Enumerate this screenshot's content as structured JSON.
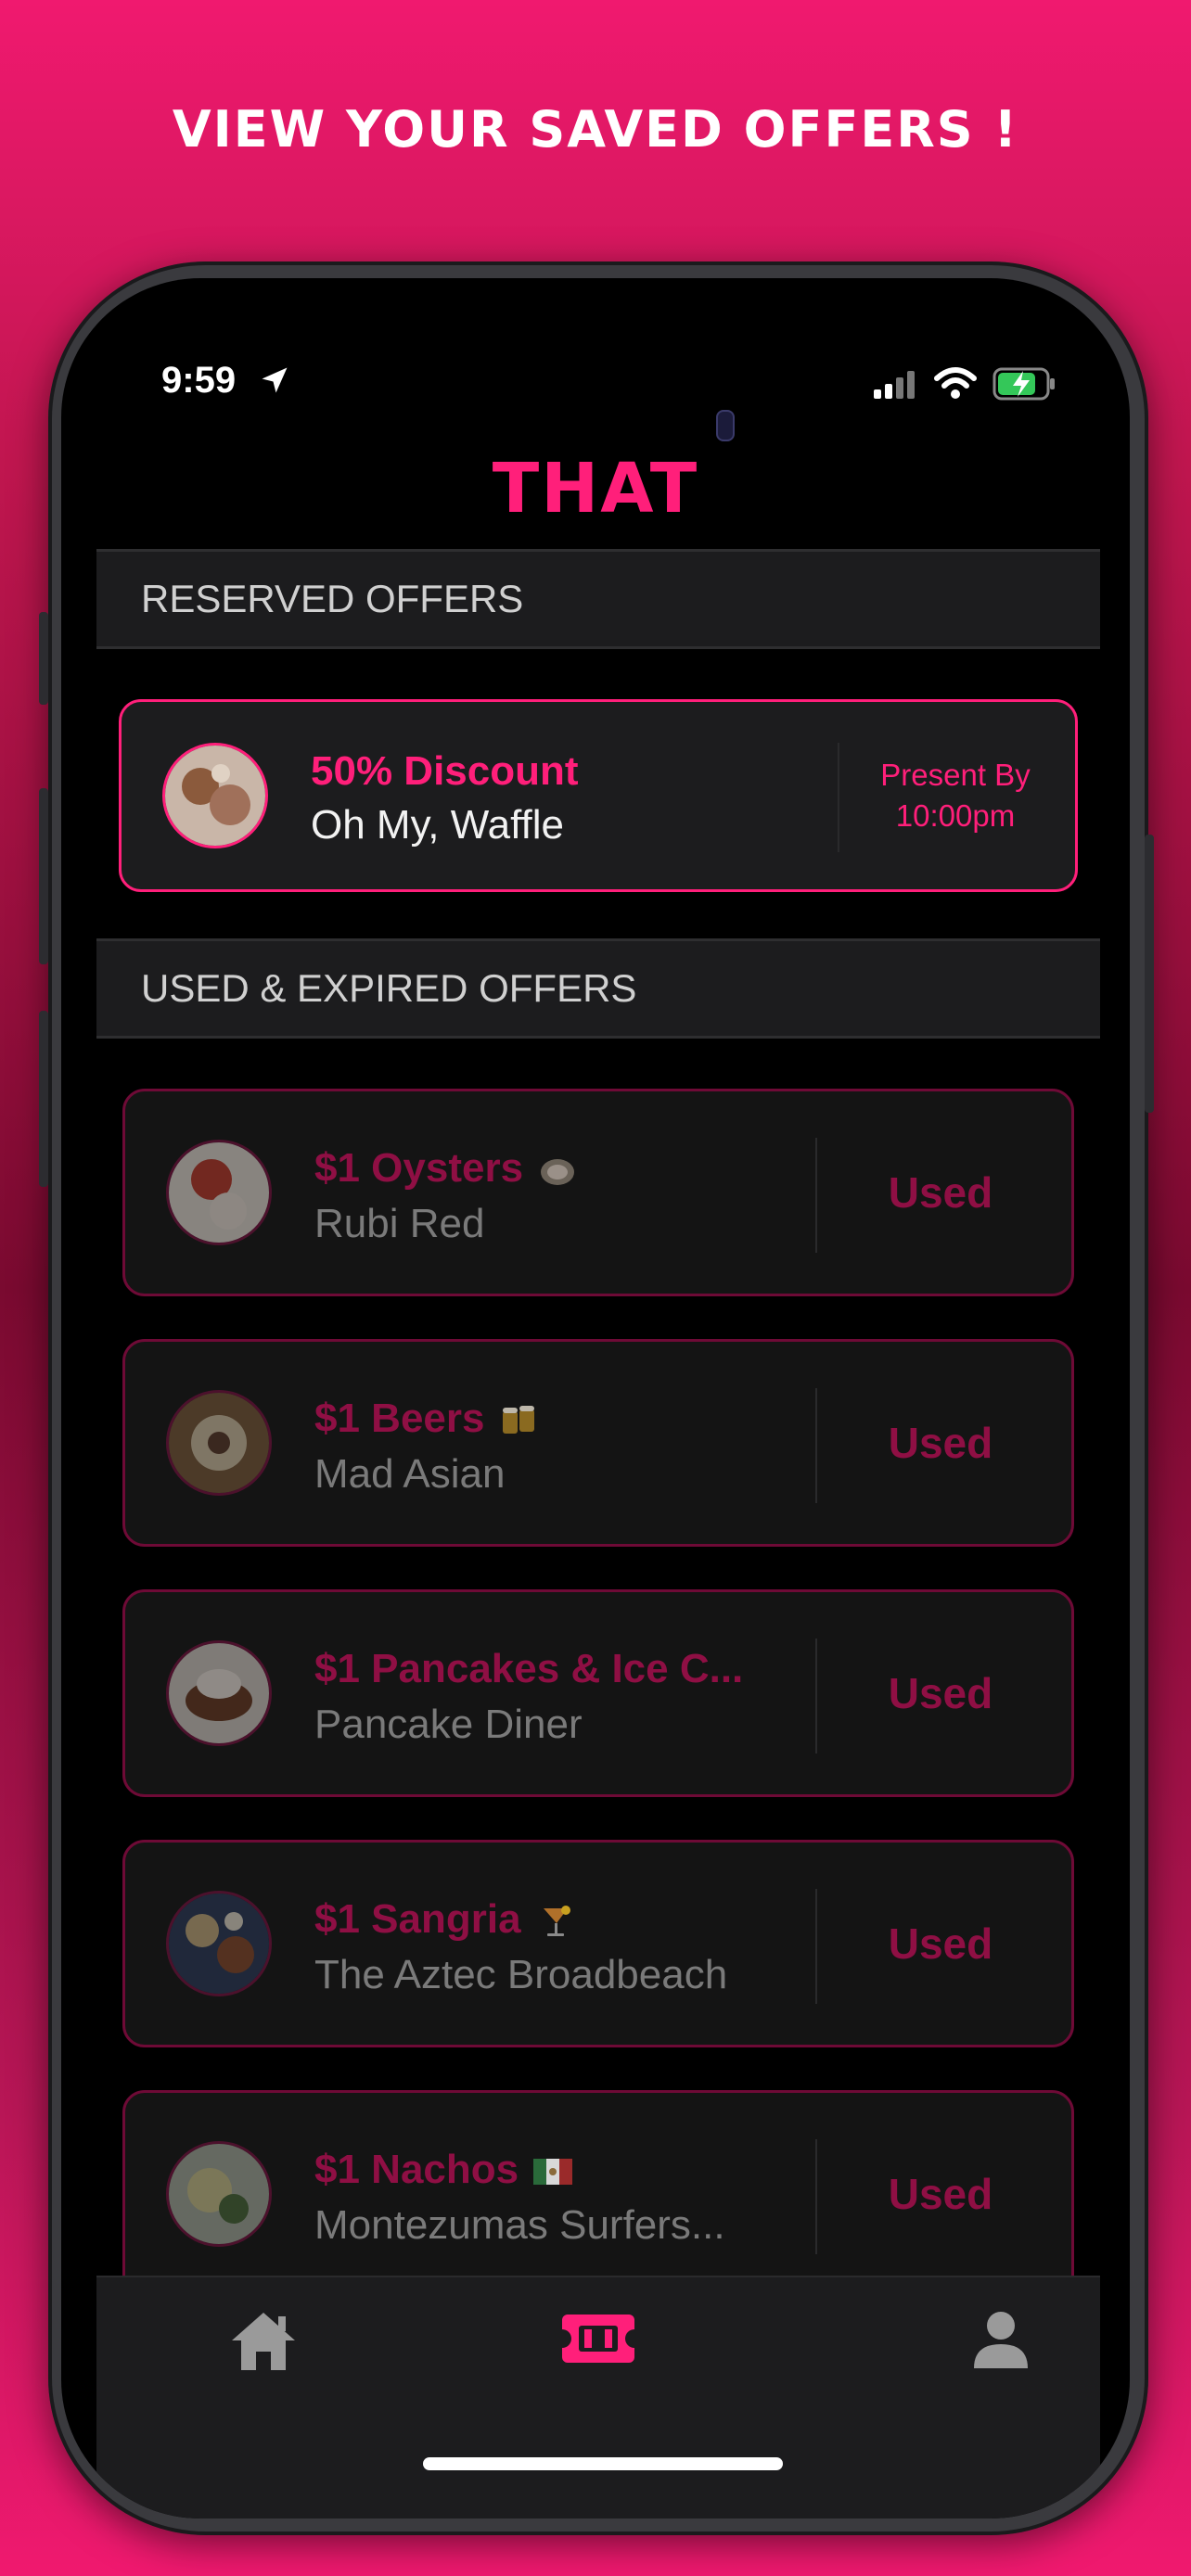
{
  "headline": "VIEW YOUR SAVED OFFERS !",
  "status_bar": {
    "time": "9:59"
  },
  "app": {
    "logo": "THAT"
  },
  "reserved": {
    "header": "RESERVED OFFERS",
    "offer": {
      "title": "50% Discount",
      "venue": "Oh My, Waffle",
      "present_label": "Present By",
      "present_time": "10:00pm"
    }
  },
  "used": {
    "header": "USED & EXPIRED OFFERS",
    "offers": [
      {
        "title": "$1 Oysters",
        "emoji": "oyster",
        "venue": "Rubi Red",
        "status": "Used"
      },
      {
        "title": "$1 Beers",
        "emoji": "beer-mugs",
        "venue": "Mad Asian",
        "status": "Used"
      },
      {
        "title": "$1 Pancakes & Ice C...",
        "emoji": "",
        "venue": "Pancake Diner",
        "status": "Used"
      },
      {
        "title": "$1 Sangria",
        "emoji": "tropical-drink",
        "venue": "The Aztec Broadbeach",
        "status": "Used"
      },
      {
        "title": "$1 Nachos",
        "emoji": "mexico-flag",
        "venue": "Montezumas Surfers...",
        "status": "Used"
      }
    ]
  },
  "tabbar": {
    "items": [
      "home-icon",
      "ticket-icon",
      "profile-icon"
    ],
    "active": "ticket-icon"
  },
  "colors": {
    "accent": "#ff1f7a",
    "accent_dim": "#8f0f44",
    "background": "#000000",
    "surface": "#1c1c1e"
  }
}
